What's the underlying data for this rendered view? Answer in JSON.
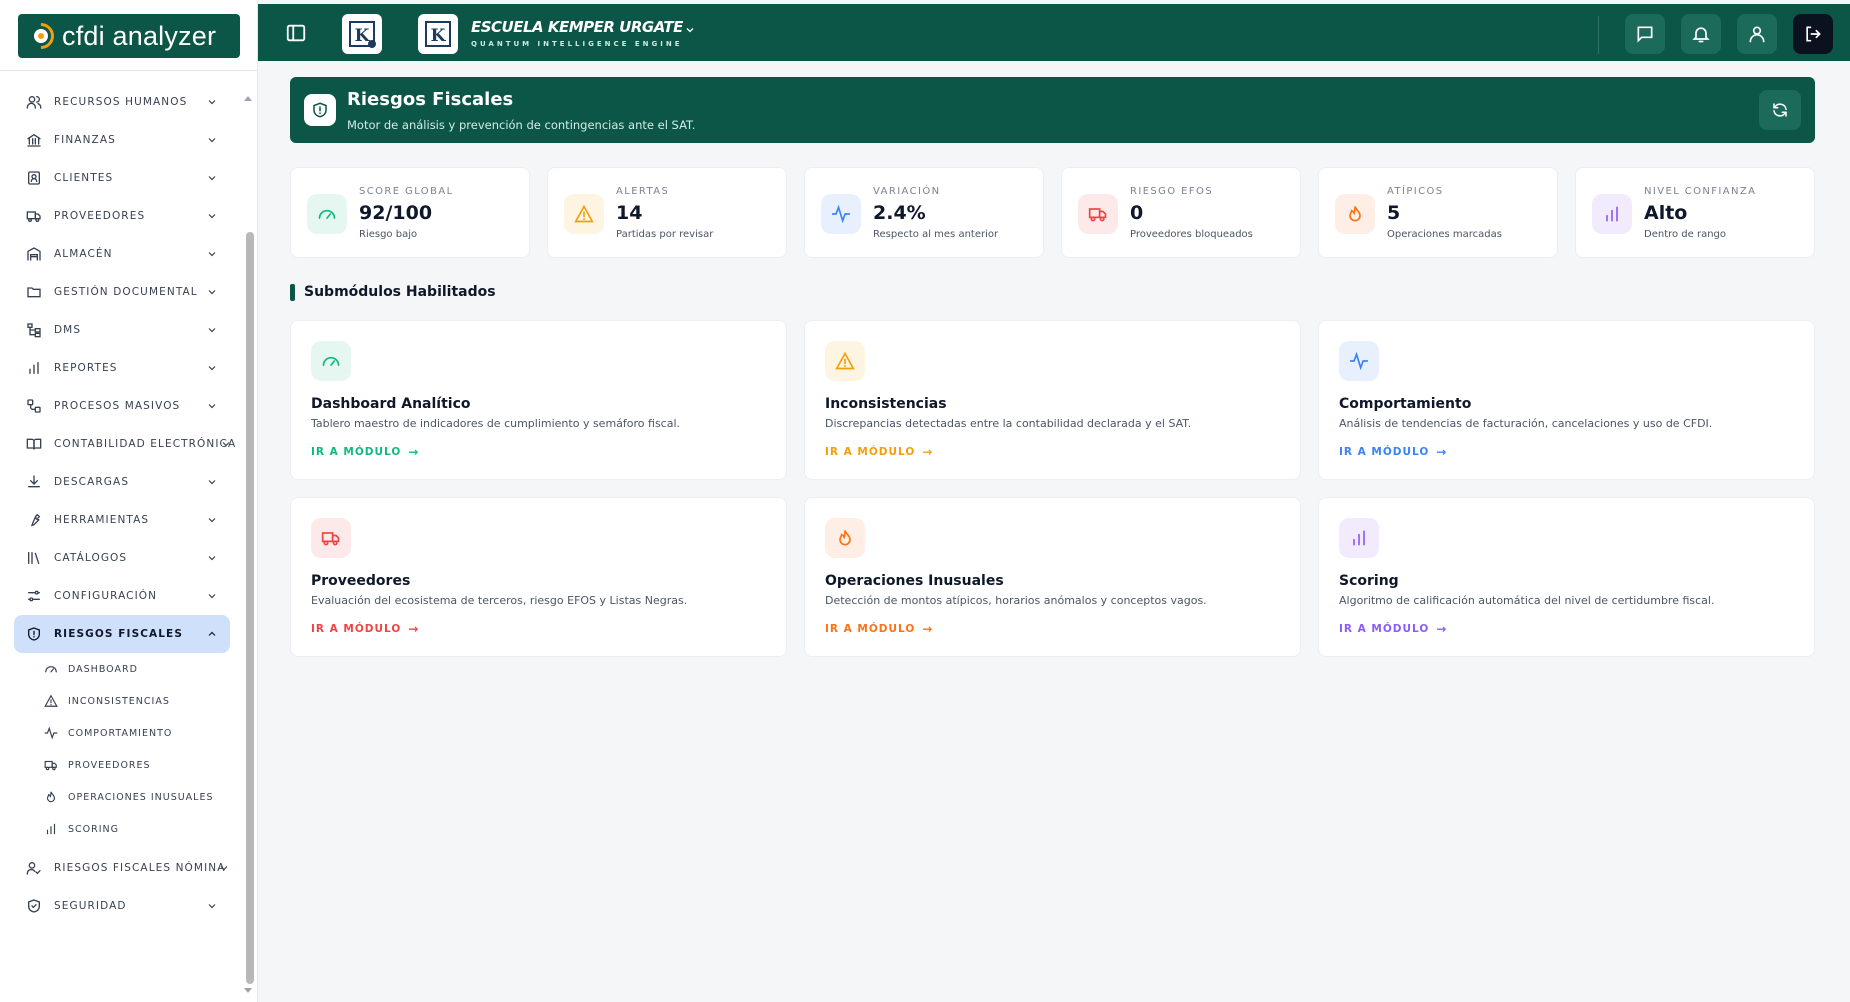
{
  "app": {
    "logo_text": "cfdi analyzer"
  },
  "colors": {
    "brand": "#0b5647",
    "active_nav": "#cfe1fa",
    "green": "#10b981",
    "amber": "#f59e0b",
    "blue": "#3b82f6",
    "red": "#ef4444",
    "orange": "#f97316",
    "purple": "#8b5cf6"
  },
  "sidebar": {
    "items": [
      {
        "label": "Recursos Humanos",
        "icon": "users-icon"
      },
      {
        "label": "Finanzas",
        "icon": "bank-icon"
      },
      {
        "label": "Clientes",
        "icon": "contact-icon"
      },
      {
        "label": "Proveedores",
        "icon": "truck-icon"
      },
      {
        "label": "Almacén",
        "icon": "warehouse-icon"
      },
      {
        "label": "Gestión Documental",
        "icon": "folder-icon"
      },
      {
        "label": "DMS",
        "icon": "tree-icon"
      },
      {
        "label": "Reportes",
        "icon": "bar-chart-icon"
      },
      {
        "label": "Procesos Masivos",
        "icon": "workflow-icon"
      },
      {
        "label": "Contabilidad Electrónica",
        "icon": "book-icon"
      },
      {
        "label": "Descargas",
        "icon": "download-icon"
      },
      {
        "label": "Herramientas",
        "icon": "wrench-icon"
      },
      {
        "label": "Catálogos",
        "icon": "library-icon"
      },
      {
        "label": "Configuración",
        "icon": "sliders-icon"
      },
      {
        "label": "Riesgos Fiscales",
        "icon": "shield-icon"
      }
    ],
    "sub_items": [
      {
        "label": "Dashboard",
        "icon": "gauge-icon"
      },
      {
        "label": "Inconsistencias",
        "icon": "warning-icon"
      },
      {
        "label": "Comportamiento",
        "icon": "activity-icon"
      },
      {
        "label": "Proveedores",
        "icon": "truck-icon"
      },
      {
        "label": "Operaciones Inusuales",
        "icon": "flame-icon"
      },
      {
        "label": "Scoring",
        "icon": "bar-chart-icon"
      }
    ],
    "after_items": [
      {
        "label": "Riesgos Fiscales Nómina",
        "icon": "user-check-icon"
      },
      {
        "label": "Seguridad",
        "icon": "shield-check-icon"
      }
    ]
  },
  "header": {
    "school_name": "ESCUELA KEMPER URGATE",
    "school_tagline": "QUANTUM INTELLIGENCE ENGINE",
    "badge_letter": "K"
  },
  "banner": {
    "title": "Riesgos Fiscales",
    "subtitle": "Motor de análisis y prevención de contingencias ante el SAT."
  },
  "stats": [
    {
      "label": "Score Global",
      "value": "92/100",
      "sub": "Riesgo bajo",
      "icon": "gauge-icon"
    },
    {
      "label": "Alertas",
      "value": "14",
      "sub": "Partidas por revisar",
      "icon": "warning-icon"
    },
    {
      "label": "Variación",
      "value": "2.4%",
      "sub": "Respecto al mes anterior",
      "icon": "activity-icon"
    },
    {
      "label": "Riesgo EFOS",
      "value": "0",
      "sub": "Proveedores bloqueados",
      "icon": "truck-icon"
    },
    {
      "label": "Atípicos",
      "value": "5",
      "sub": "Operaciones marcadas",
      "icon": "flame-icon"
    },
    {
      "label": "Nivel Confianza",
      "value": "Alto",
      "sub": "Dentro de rango",
      "icon": "bar-chart-icon"
    }
  ],
  "section_title": "Submódulos Habilitados",
  "modules": [
    {
      "title": "Dashboard Analítico",
      "desc": "Tablero maestro de indicadores de cumplimiento y semáforo fiscal.",
      "link": "IR A MÓDULO",
      "icon": "gauge-icon"
    },
    {
      "title": "Inconsistencias",
      "desc": "Discrepancias detectadas entre la contabilidad declarada y el SAT.",
      "link": "IR A MÓDULO",
      "icon": "warning-icon"
    },
    {
      "title": "Comportamiento",
      "desc": "Análisis de tendencias de facturación, cancelaciones y uso de CFDI.",
      "link": "IR A MÓDULO",
      "icon": "activity-icon"
    },
    {
      "title": "Proveedores",
      "desc": "Evaluación del ecosistema de terceros, riesgo EFOS y Listas Negras.",
      "link": "IR A MÓDULO",
      "icon": "truck-icon"
    },
    {
      "title": "Operaciones Inusuales",
      "desc": "Detección de montos atípicos, horarios anómalos y conceptos vagos.",
      "link": "IR A MÓDULO",
      "icon": "flame-icon"
    },
    {
      "title": "Scoring",
      "desc": "Algoritmo de calificación automática del nivel de certidumbre fiscal.",
      "link": "IR A MÓDULO",
      "icon": "bar-chart-icon"
    }
  ]
}
